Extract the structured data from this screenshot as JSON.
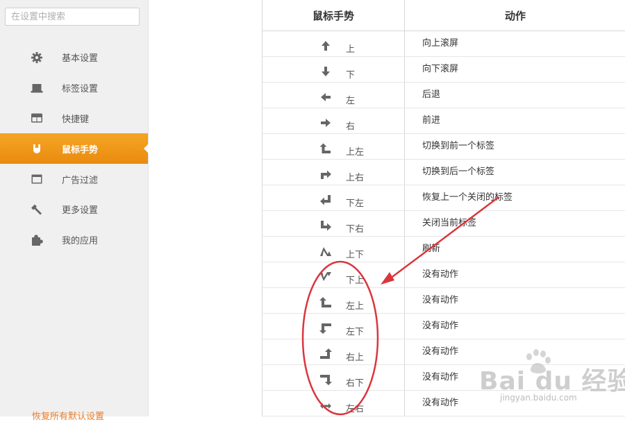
{
  "search": {
    "placeholder": "在设置中搜索"
  },
  "colors": {
    "accent": "#f0951a",
    "annotation": "#d9363e",
    "restore": "#e87d2a"
  },
  "sidebar": {
    "items": [
      {
        "label": "基本设置",
        "icon": "gear-icon",
        "active": false
      },
      {
        "label": "标签设置",
        "icon": "laptop-icon",
        "active": false
      },
      {
        "label": "快捷键",
        "icon": "layout-icon",
        "active": false
      },
      {
        "label": "鼠标手势",
        "icon": "mouse-icon",
        "active": true
      },
      {
        "label": "广告过滤",
        "icon": "window-icon",
        "active": false
      },
      {
        "label": "更多设置",
        "icon": "wrench-icon",
        "active": false
      },
      {
        "label": "我的应用",
        "icon": "puzzle-icon",
        "active": false
      }
    ],
    "restore_label": "恢复所有默认设置"
  },
  "table": {
    "headers": {
      "gesture": "鼠标手势",
      "action": "动作"
    },
    "rows": [
      {
        "gesture": "上",
        "icon": "arrow-up-icon",
        "action": "向上滚屏"
      },
      {
        "gesture": "下",
        "icon": "arrow-down-icon",
        "action": "向下滚屏"
      },
      {
        "gesture": "左",
        "icon": "arrow-left-icon",
        "action": "后退"
      },
      {
        "gesture": "右",
        "icon": "arrow-right-icon",
        "action": "前进"
      },
      {
        "gesture": "上左",
        "icon": "arrow-up-left-icon",
        "action": "切换到前一个标签"
      },
      {
        "gesture": "上右",
        "icon": "arrow-up-right-icon",
        "action": "切换到后一个标签"
      },
      {
        "gesture": "下左",
        "icon": "arrow-down-left-icon",
        "action": "恢复上一个关闭的标签"
      },
      {
        "gesture": "下右",
        "icon": "arrow-down-right-icon",
        "action": "关闭当前标签"
      },
      {
        "gesture": "上下",
        "icon": "arrow-up-down-icon",
        "action": "刷新"
      },
      {
        "gesture": "下上",
        "icon": "arrow-down-up-icon",
        "action": "没有动作"
      },
      {
        "gesture": "左上",
        "icon": "arrow-left-up-icon",
        "action": "没有动作"
      },
      {
        "gesture": "左下",
        "icon": "arrow-left-down-icon",
        "action": "没有动作"
      },
      {
        "gesture": "右上",
        "icon": "arrow-right-up-icon",
        "action": "没有动作"
      },
      {
        "gesture": "右下",
        "icon": "arrow-right-down-icon",
        "action": "没有动作"
      },
      {
        "gesture": "左右",
        "icon": "arrow-left-right-icon",
        "action": "没有动作"
      }
    ]
  },
  "watermark": {
    "text": "Bai du 经验",
    "url": "jingyan.baidu.com"
  }
}
